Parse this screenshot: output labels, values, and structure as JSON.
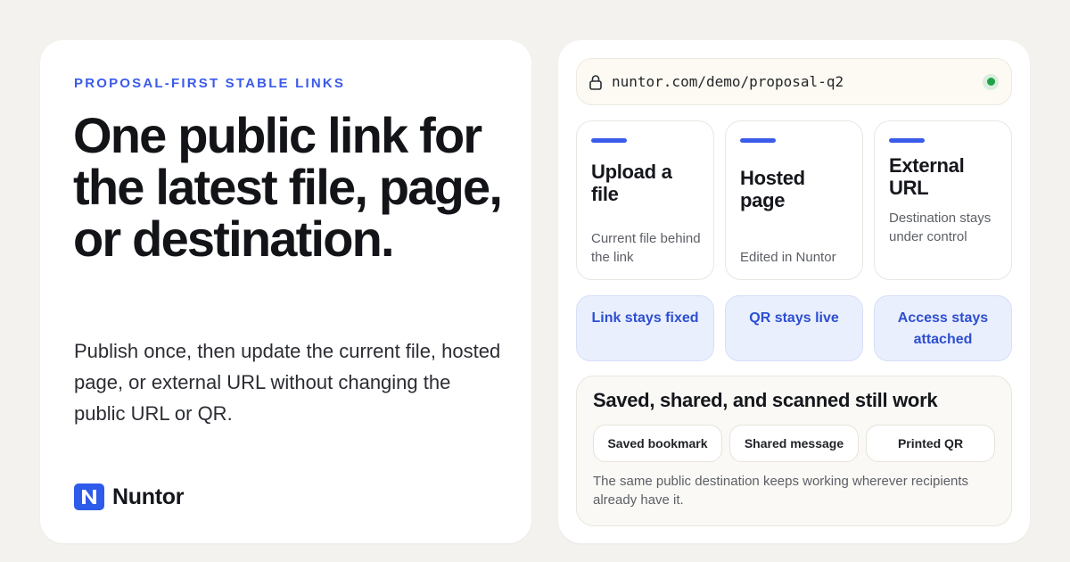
{
  "left": {
    "eyebrow": "PROPOSAL-FIRST STABLE LINKS",
    "headline": "One public link for the latest file, page, or destination.",
    "subtext": "Publish once, then update the current file, hosted page, or external URL without changing the public URL or QR.",
    "brand": {
      "name": "Nuntor",
      "logo_icon": "n-logo-icon"
    }
  },
  "right": {
    "url_bar": {
      "url": "nuntor.com/demo/proposal-q2",
      "lock_icon": "lock-icon",
      "status": "live-indicator"
    },
    "options": [
      {
        "title": "Upload a file",
        "desc": "Current file behind the link"
      },
      {
        "title": "Hosted page",
        "desc": "Edited in Nuntor"
      },
      {
        "title": "External URL",
        "desc": "Destination stays under control"
      }
    ],
    "pills": [
      {
        "label": "Link stays fixed"
      },
      {
        "label": "QR stays live"
      },
      {
        "label": "Access stays attached"
      }
    ],
    "works": {
      "title": "Saved, shared, and scanned still work",
      "chips": [
        "Saved bookmark",
        "Shared message",
        "Printed QR"
      ],
      "note": "The same public destination keeps working wherever recipients already have it."
    }
  },
  "colors": {
    "accent": "#3b5bea",
    "pill_bg": "#eaeffd",
    "status_green": "#1fa24a",
    "page_bg": "#f4f2ee"
  }
}
